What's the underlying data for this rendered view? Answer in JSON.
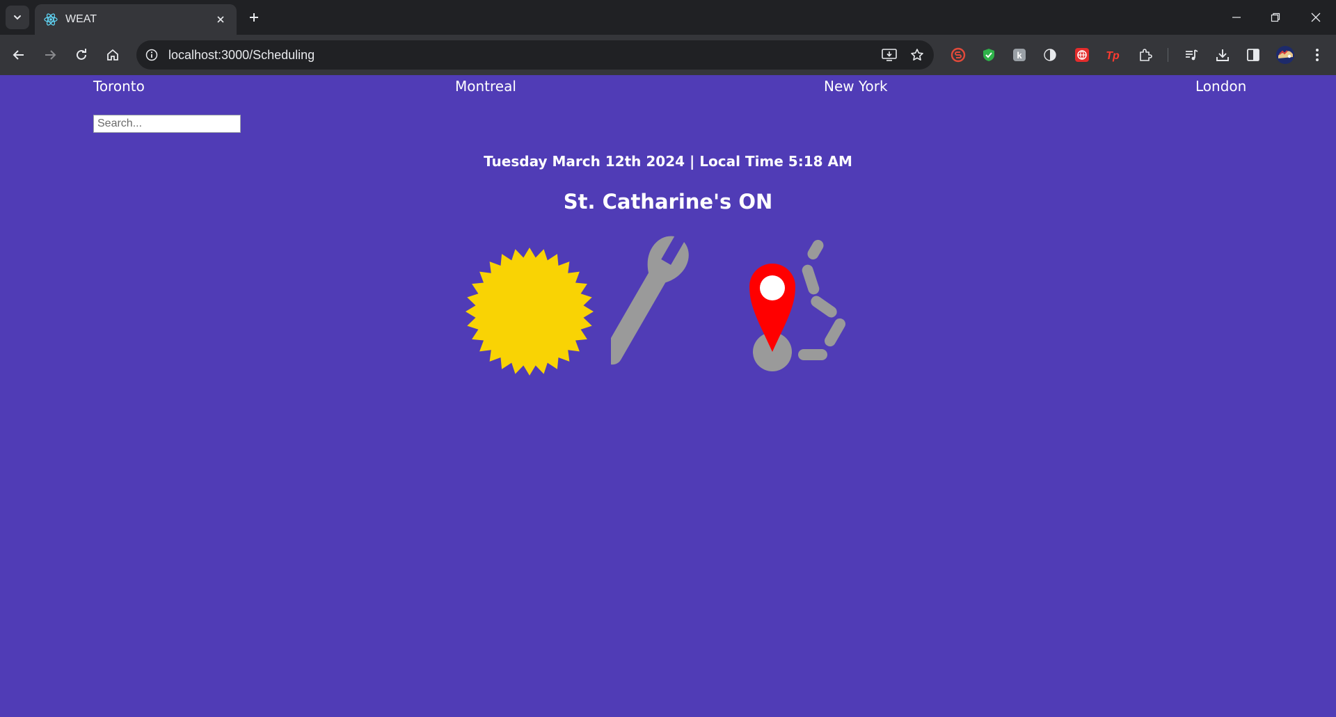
{
  "browser": {
    "tab_title": "WEAT",
    "url": "localhost:3000/Scheduling",
    "icons": [
      "tab-list-icon",
      "react-icon",
      "close-icon",
      "plus-icon",
      "minimize-icon",
      "restore-icon",
      "close-window-icon",
      "back-icon",
      "forward-icon",
      "reload-icon",
      "home-icon",
      "info-icon",
      "install-app-icon",
      "star-icon",
      "extensions-icon",
      "media-icon",
      "download-icon",
      "side-panel-icon",
      "profile-avatar",
      "menu-icon"
    ]
  },
  "nav": {
    "cities": [
      "Toronto",
      "Montreal",
      "New York",
      "London"
    ]
  },
  "search": {
    "placeholder": "Search..."
  },
  "header": {
    "date_time": "Tuesday March 12th 2024 | Local Time 5:18 AM",
    "location": "St. Catharine's ON"
  },
  "weather_icons": [
    "sun-icon",
    "wrench-icon",
    "location-pin-icon"
  ],
  "colors": {
    "background": "#503cb6",
    "sun": "#f9d304",
    "tool_gray": "#9a9a9a",
    "pin_red": "#ff0000"
  }
}
